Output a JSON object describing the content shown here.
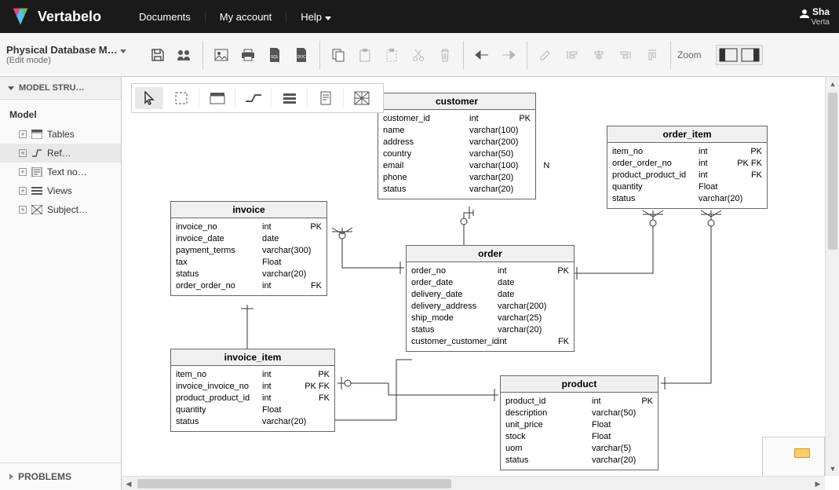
{
  "brand": "Vertabelo",
  "top_links": {
    "documents": "Documents",
    "account": "My account",
    "help": "Help"
  },
  "user": {
    "name": "Sha",
    "sub": "Verta"
  },
  "doc": {
    "title": "Physical Database M…",
    "mode": "(Edit mode)"
  },
  "toolbar": {
    "zoom": "Zoom"
  },
  "sidebar": {
    "header": "MODEL STRU…",
    "root": "Model",
    "items": {
      "tables": "Tables",
      "refs": "Ref…",
      "textnotes": "Text no…",
      "views": "Views",
      "subject": "Subject…"
    },
    "problems": "PROBLEMS"
  },
  "tables": {
    "customer": {
      "title": "customer",
      "cols": [
        {
          "n": "customer_id",
          "t": "int",
          "k": "PK"
        },
        {
          "n": "name",
          "t": "varchar(100)",
          "k": ""
        },
        {
          "n": "address",
          "t": "varchar(200)",
          "k": ""
        },
        {
          "n": "country",
          "t": "varchar(50)",
          "k": ""
        },
        {
          "n": "email",
          "t": "varchar(100)",
          "k": "N"
        },
        {
          "n": "phone",
          "t": "varchar(20)",
          "k": ""
        },
        {
          "n": "status",
          "t": "varchar(20)",
          "k": ""
        }
      ]
    },
    "order_item": {
      "title": "order_item",
      "cols": [
        {
          "n": "item_no",
          "t": "int",
          "k": "PK"
        },
        {
          "n": "order_order_no",
          "t": "int",
          "k": "PK FK"
        },
        {
          "n": "product_product_id",
          "t": "int",
          "k": "FK"
        },
        {
          "n": "quantity",
          "t": "Float",
          "k": ""
        },
        {
          "n": "status",
          "t": "varchar(20)",
          "k": ""
        }
      ]
    },
    "invoice": {
      "title": "invoice",
      "cols": [
        {
          "n": "invoice_no",
          "t": "int",
          "k": "PK"
        },
        {
          "n": "invoice_date",
          "t": "date",
          "k": ""
        },
        {
          "n": "payment_terms",
          "t": "varchar(300)",
          "k": ""
        },
        {
          "n": "tax",
          "t": "Float",
          "k": ""
        },
        {
          "n": "status",
          "t": "varchar(20)",
          "k": ""
        },
        {
          "n": "order_order_no",
          "t": "int",
          "k": "FK"
        }
      ]
    },
    "order": {
      "title": "order",
      "cols": [
        {
          "n": "order_no",
          "t": "int",
          "k": "PK"
        },
        {
          "n": "order_date",
          "t": "date",
          "k": ""
        },
        {
          "n": "delivery_date",
          "t": "date",
          "k": ""
        },
        {
          "n": "delivery_address",
          "t": "varchar(200)",
          "k": ""
        },
        {
          "n": "ship_mode",
          "t": "varchar(25)",
          "k": ""
        },
        {
          "n": "status",
          "t": "varchar(20)",
          "k": ""
        },
        {
          "n": "customer_customer_id",
          "t": "int",
          "k": "FK"
        }
      ]
    },
    "invoice_item": {
      "title": "invoice_item",
      "cols": [
        {
          "n": "item_no",
          "t": "int",
          "k": "PK"
        },
        {
          "n": "invoice_invoice_no",
          "t": "int",
          "k": "PK FK"
        },
        {
          "n": "product_product_id",
          "t": "int",
          "k": "FK"
        },
        {
          "n": "quantity",
          "t": "Float",
          "k": ""
        },
        {
          "n": "status",
          "t": "varchar(20)",
          "k": ""
        }
      ]
    },
    "product": {
      "title": "product",
      "cols": [
        {
          "n": "product_id",
          "t": "int",
          "k": "PK"
        },
        {
          "n": "description",
          "t": "varchar(50)",
          "k": ""
        },
        {
          "n": "unit_price",
          "t": "Float",
          "k": ""
        },
        {
          "n": "stock",
          "t": "Float",
          "k": ""
        },
        {
          "n": "uom",
          "t": "varchar(5)",
          "k": ""
        },
        {
          "n": "status",
          "t": "varchar(20)",
          "k": ""
        }
      ]
    }
  }
}
